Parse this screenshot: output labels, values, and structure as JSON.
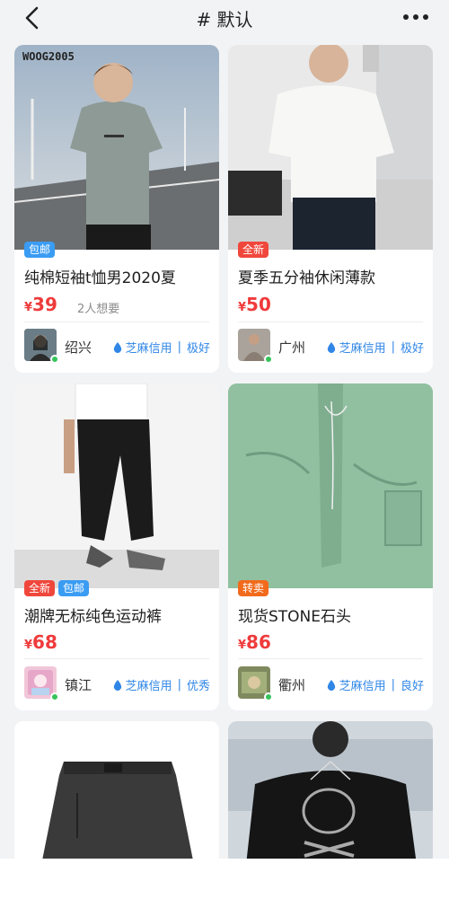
{
  "header": {
    "title": "# 默认",
    "back_icon": "chevron-left-icon",
    "more_icon": "more-dots-icon"
  },
  "products": [
    {
      "tags": [
        {
          "label": "包邮",
          "type": "baoyou"
        }
      ],
      "title": "纯棉短袖t恤男2020夏",
      "currency": "¥",
      "price": "39",
      "want": "2人想要",
      "city": "绍兴",
      "credit": "芝麻信用",
      "credit_level": "极好",
      "image_text": "WOOG2005"
    },
    {
      "tags": [
        {
          "label": "全新",
          "type": "quanxin"
        }
      ],
      "title": "夏季五分袖休闲薄款",
      "currency": "¥",
      "price": "50",
      "want": "",
      "city": "广州",
      "credit": "芝麻信用",
      "credit_level": "极好"
    },
    {
      "tags": [
        {
          "label": "全新",
          "type": "quanxin"
        },
        {
          "label": "包邮",
          "type": "baoyou"
        }
      ],
      "title": "潮牌无标纯色运动裤",
      "currency": "¥",
      "price": "68",
      "want": "",
      "city": "镇江",
      "credit": "芝麻信用",
      "credit_level": "优秀"
    },
    {
      "tags": [
        {
          "label": "转卖",
          "type": "zhuanmai"
        }
      ],
      "title": "现货STONE石头",
      "currency": "¥",
      "price": "86",
      "want": "",
      "city": "衢州",
      "credit": "芝麻信用",
      "credit_level": "良好"
    }
  ],
  "colors": {
    "price": "#ef3b3b",
    "credit": "#2f86e6",
    "tag_baoyou": "#3a9cf3",
    "tag_quanxin": "#f0473c",
    "tag_zhuanmai": "#f26a1b",
    "online_dot": "#35c35a"
  }
}
